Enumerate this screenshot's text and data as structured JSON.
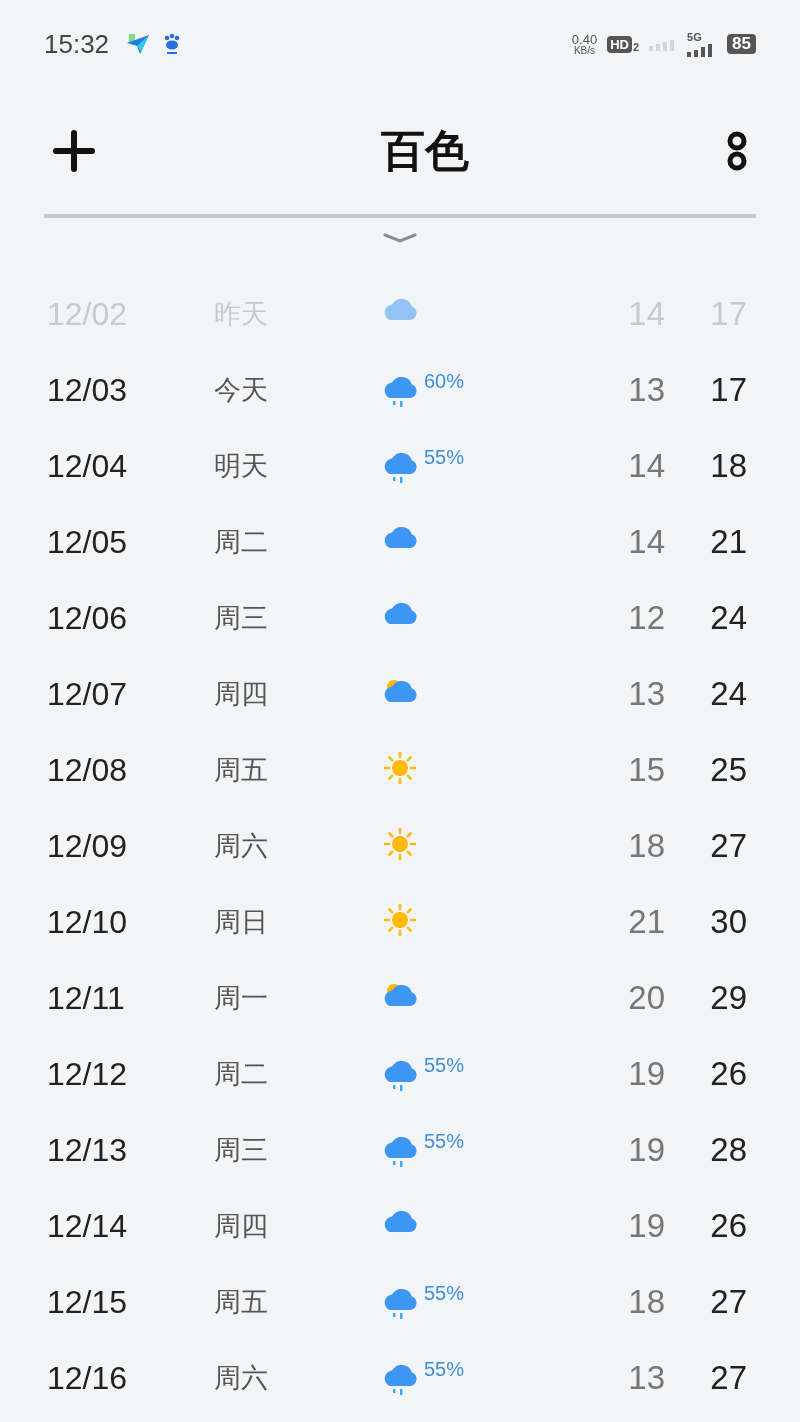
{
  "status_bar": {
    "time": "15:32",
    "net_speed": "0.40",
    "net_unit": "KB/s",
    "hd": "HD",
    "sim": "2",
    "network": "5G",
    "battery": "85"
  },
  "header": {
    "title": "百色"
  },
  "forecast": [
    {
      "date": "12/02",
      "day": "昨天",
      "kind": "cloudy",
      "low": "14",
      "high": "17",
      "past": true
    },
    {
      "date": "12/03",
      "day": "今天",
      "kind": "rain",
      "precip": "60%",
      "low": "13",
      "high": "17",
      "past": false
    },
    {
      "date": "12/04",
      "day": "明天",
      "kind": "rain",
      "precip": "55%",
      "low": "14",
      "high": "18",
      "past": false
    },
    {
      "date": "12/05",
      "day": "周二",
      "kind": "cloudy",
      "low": "14",
      "high": "21",
      "past": false
    },
    {
      "date": "12/06",
      "day": "周三",
      "kind": "cloudy",
      "low": "12",
      "high": "24",
      "past": false
    },
    {
      "date": "12/07",
      "day": "周四",
      "kind": "partly",
      "low": "13",
      "high": "24",
      "past": false
    },
    {
      "date": "12/08",
      "day": "周五",
      "kind": "sunny",
      "low": "15",
      "high": "25",
      "past": false
    },
    {
      "date": "12/09",
      "day": "周六",
      "kind": "sunny",
      "low": "18",
      "high": "27",
      "past": false
    },
    {
      "date": "12/10",
      "day": "周日",
      "kind": "sunny",
      "low": "21",
      "high": "30",
      "past": false
    },
    {
      "date": "12/11",
      "day": "周一",
      "kind": "partly",
      "low": "20",
      "high": "29",
      "past": false
    },
    {
      "date": "12/12",
      "day": "周二",
      "kind": "rain",
      "precip": "55%",
      "low": "19",
      "high": "26",
      "past": false
    },
    {
      "date": "12/13",
      "day": "周三",
      "kind": "rain",
      "precip": "55%",
      "low": "19",
      "high": "28",
      "past": false
    },
    {
      "date": "12/14",
      "day": "周四",
      "kind": "cloudy",
      "low": "19",
      "high": "26",
      "past": false
    },
    {
      "date": "12/15",
      "day": "周五",
      "kind": "rain",
      "precip": "55%",
      "low": "18",
      "high": "27",
      "past": false
    },
    {
      "date": "12/16",
      "day": "周六",
      "kind": "rain",
      "precip": "55%",
      "low": "13",
      "high": "27",
      "past": false
    }
  ]
}
